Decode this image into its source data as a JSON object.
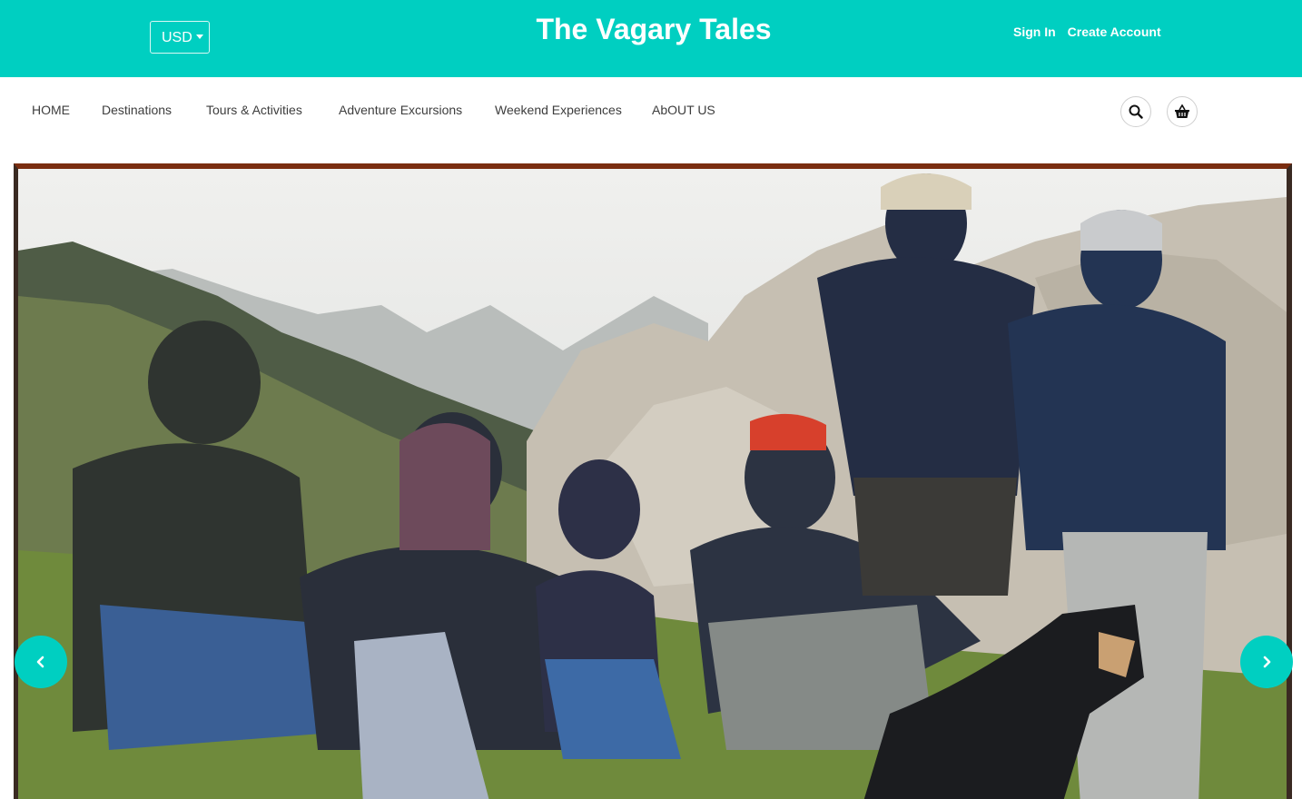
{
  "header": {
    "currency": "USD",
    "title": "The Vagary Tales",
    "sign_in": "Sign In",
    "create_account": "Create Account"
  },
  "nav": {
    "items": [
      "HOME",
      "Destinations",
      "Tours & Activities",
      "Adventure Excursions",
      "Weekend Experiences",
      "AbOUT US"
    ]
  },
  "icons": {
    "search": "search-icon",
    "basket": "basket-icon",
    "prev": "chevron-left-icon",
    "next": "chevron-right-icon"
  },
  "colors": {
    "brand": "#00cfc1",
    "nav_text": "#3d3d3d"
  }
}
